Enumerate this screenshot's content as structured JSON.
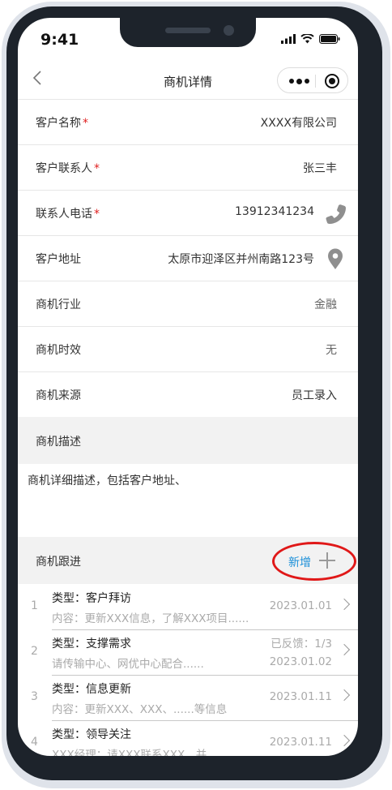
{
  "status_bar": {
    "time": "9:41"
  },
  "nav": {
    "back_icon": "chevron-left-icon",
    "title": "商机详情",
    "more_icon": "more-dots-icon",
    "close_icon": "target-close-icon"
  },
  "fields": {
    "customer_name": {
      "label": "客户名称",
      "required": "*",
      "value": "XXXX有限公司"
    },
    "contact": {
      "label": "客户联系人",
      "required": "*",
      "value": "张三丰"
    },
    "phone": {
      "label": "联系人电话",
      "required": "*",
      "value": "13912341234",
      "icon": "phone-icon"
    },
    "address": {
      "label": "客户地址",
      "value": "太原市迎泽区并州南路123号",
      "icon": "location-pin-icon"
    },
    "industry": {
      "label": "商机行业",
      "value": "金融"
    },
    "timeliness": {
      "label": "商机时效",
      "value": "无"
    },
    "source": {
      "label": "商机来源",
      "value": "员工录入"
    }
  },
  "description": {
    "label": "商机描述",
    "text": "商机详细描述，包括客户地址、"
  },
  "follow_up": {
    "label": "商机跟进",
    "add_label": "新增",
    "items": [
      {
        "index": "1",
        "type": "类型：客户拜访",
        "content": "内容：更新XXX信息，了解XXX项目......",
        "date": "2023.01.01",
        "feedback": ""
      },
      {
        "index": "2",
        "type": "类型：支撑需求",
        "content": "请传输中心、网优中心配合......",
        "date": "2023.01.02",
        "feedback": "已反馈：1/3"
      },
      {
        "index": "3",
        "type": "类型：信息更新",
        "content": "内容：更新XXX、XXX、......等信息",
        "date": "2023.01.11",
        "feedback": ""
      },
      {
        "index": "4",
        "type": "类型：领导关注",
        "content": "XXX经理：请XXX联系XXX，并......",
        "date": "2023.01.11",
        "feedback": ""
      }
    ]
  },
  "colors": {
    "accent": "#1a8fd8",
    "required": "#e02020",
    "highlight": "#e01818",
    "section_bg": "#f2f2f2"
  }
}
